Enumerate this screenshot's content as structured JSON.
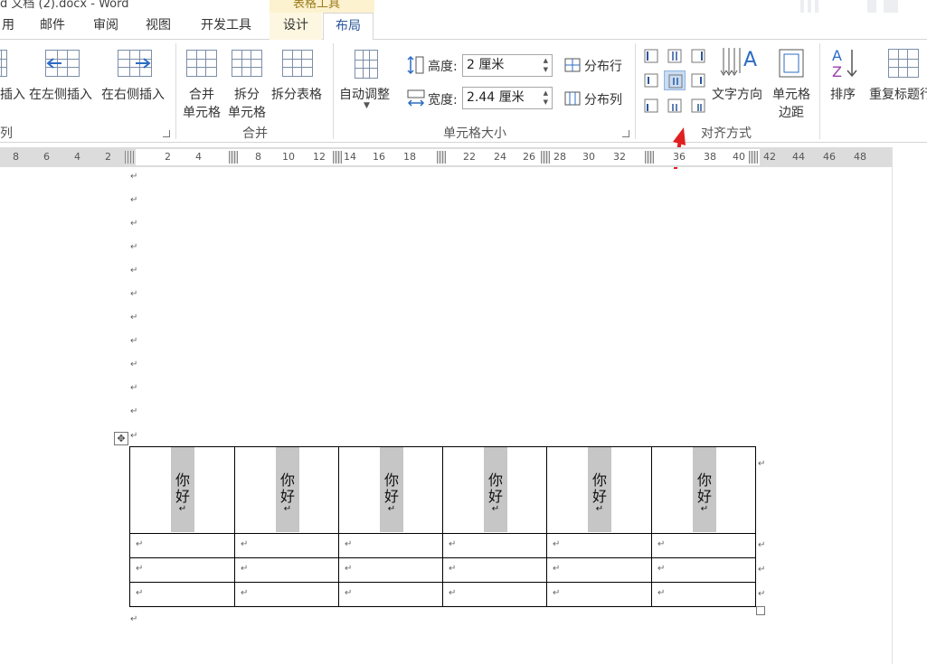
{
  "app": {
    "document_title": "d 文档 (2).docx - Word",
    "context_tab_group": "表格工具"
  },
  "tabs": [
    "用",
    "邮件",
    "审阅",
    "视图",
    "开发工具",
    "设计",
    "布局"
  ],
  "ribbon": {
    "rows_cols_group": {
      "insert_below_partial": "插入",
      "insert_left": "在左侧插入",
      "insert_right": "在右侧插入",
      "label_partial": "列"
    },
    "merge_group": {
      "merge_cells_l1": "合并",
      "merge_cells_l2": "单元格",
      "split_cells_l1": "拆分",
      "split_cells_l2": "单元格",
      "split_table": "拆分表格",
      "label": "合并"
    },
    "cell_size_group": {
      "autofit": "自动调整",
      "height_label": "高度:",
      "height_value": "2 厘米",
      "width_label": "宽度:",
      "width_value": "2.44 厘米",
      "distribute_rows": "分布行",
      "distribute_cols": "分布列",
      "label": "单元格大小"
    },
    "alignment_group": {
      "text_direction": "文字方向",
      "cell_margins_l1": "单元格",
      "cell_margins_l2": "边距",
      "label": "对齐方式"
    },
    "data_group": {
      "sort": "排序",
      "repeat_header_partial": "重复标题行"
    }
  },
  "ruler": {
    "left_ticks": [
      "8",
      "6",
      "4",
      "2"
    ],
    "ticks": [
      "2",
      "4",
      "8",
      "10",
      "12",
      "14",
      "16",
      "18",
      "22",
      "24",
      "26",
      "28",
      "30",
      "32",
      "36",
      "38",
      "40",
      "42",
      "44",
      "46",
      "48"
    ]
  },
  "document": {
    "table": {
      "header_cells": [
        "你好",
        "你好",
        "你好",
        "你好",
        "你好",
        "你好"
      ],
      "cell_text_direction": "vertical",
      "body_rows": 3,
      "columns": 6
    },
    "paragraph_mark": "↵"
  },
  "colors": {
    "accent": "#2b579a",
    "context_tab": "#fdf2cf",
    "selected_button": "#c9dcf3",
    "cell_highlight": "#c6c6c6",
    "annotation_arrow": "#e02020"
  }
}
